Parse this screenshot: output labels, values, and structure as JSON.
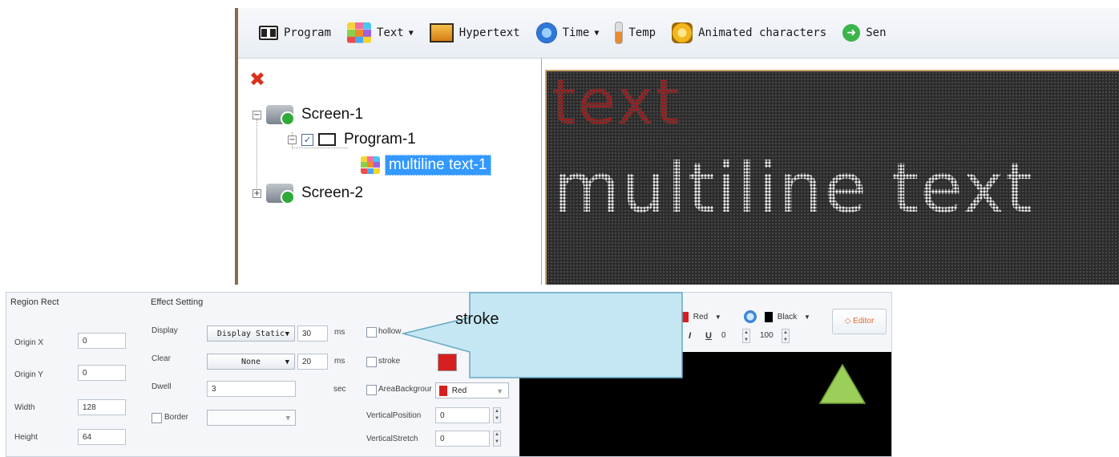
{
  "toolbar": {
    "items": [
      {
        "label": "Program",
        "icon": "program-icon"
      },
      {
        "label": "Text",
        "icon": "text-icon",
        "dropdown": true
      },
      {
        "label": "Hypertext",
        "icon": "hypertext-icon"
      },
      {
        "label": "Time",
        "icon": "clock-icon",
        "dropdown": true
      },
      {
        "label": "Temp",
        "icon": "thermometer-icon"
      },
      {
        "label": "Animated characters",
        "icon": "animated-characters-icon"
      },
      {
        "label": "Sen",
        "icon": "send-icon"
      }
    ]
  },
  "tree": {
    "screen1": "Screen-1",
    "program1": "Program-1",
    "item1": "multiline text-1",
    "screen2": "Screen-2"
  },
  "led": {
    "line1": "text",
    "line2": "multiline text",
    "line1_color": "#c81a1a",
    "line2_color": "#eeeeee"
  },
  "region": {
    "title": "Region Rect",
    "origin_x_label": "Origin X",
    "origin_x": "0",
    "origin_y_label": "Origin Y",
    "origin_y": "0",
    "width_label": "Width",
    "width": "128",
    "height_label": "Height",
    "height": "64"
  },
  "effect": {
    "title": "Effect Setting",
    "display_label": "Display",
    "display_value": "Display Static",
    "display_time": "30",
    "display_unit": "ms",
    "clear_label": "Clear",
    "clear_value": "None",
    "clear_time": "20",
    "clear_unit": "ms",
    "dwell_label": "Dwell",
    "dwell_value": "3",
    "dwell_unit": "sec",
    "border_label": "Border"
  },
  "options": {
    "hollow_label": "hollow",
    "stroke_label": "stroke",
    "area_bg_label": "AreaBackgrour",
    "area_bg_color_name": "Red",
    "vpos_label": "VerticalPosition",
    "vpos_value": "0",
    "vstretch_label": "VerticalStretch",
    "vstretch_value": "0"
  },
  "text_format": {
    "fg_color": "Red",
    "bg_color": "Black",
    "italic": "I",
    "underline": "U",
    "spacing_value": "0",
    "scale_value": "100",
    "editor_label": "Editor"
  },
  "preview": {
    "text": "multiline text"
  },
  "callout": {
    "label": "stroke"
  },
  "colors": {
    "red": "#d81f1f",
    "black": "#000000",
    "callout_fill": "#bfe6f3",
    "triangle_fill": "#9ccf5a"
  }
}
